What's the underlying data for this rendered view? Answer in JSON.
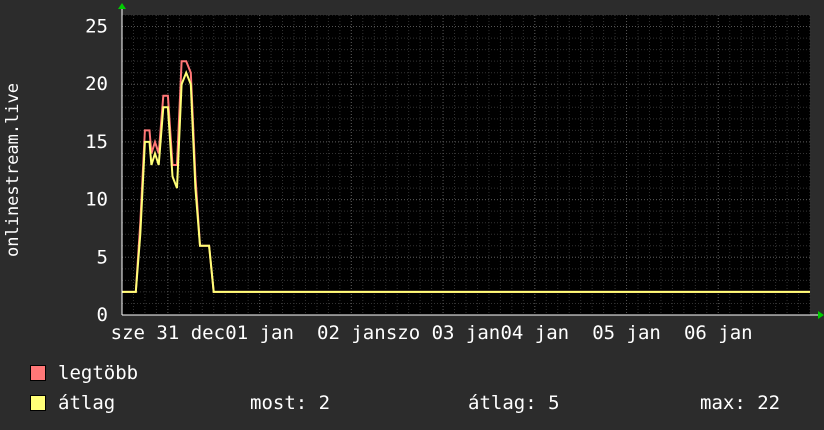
{
  "chart_data": {
    "type": "line",
    "ylabel": "onlinestream.live",
    "ylim": [
      0,
      26
    ],
    "yticks": [
      0,
      5,
      10,
      15,
      20,
      25
    ],
    "xticks": [
      "sze 31 dec",
      "01 jan",
      "02 jan",
      "szo 03 jan",
      "04 jan",
      "05 jan",
      "06 jan"
    ],
    "xtick_positions": [
      0.5,
      1.5,
      2.5,
      3.5,
      4.5,
      5.5,
      6.5
    ],
    "xlim": [
      0,
      7.5
    ],
    "grid": true,
    "colors": {
      "max": "#ff7777",
      "avg": "#ffff77",
      "background": "#000000",
      "grid": "#555555",
      "axis": "#ffffff",
      "arrow": "#00cc00"
    },
    "series": [
      {
        "name": "legtöbb",
        "x": [
          0,
          0.05,
          0.1,
          0.15,
          0.2,
          0.25,
          0.3,
          0.32,
          0.36,
          0.4,
          0.45,
          0.5,
          0.55,
          0.6,
          0.65,
          0.7,
          0.75,
          0.8,
          0.85,
          0.9,
          0.95,
          1.0,
          1.05,
          1.1,
          1.15,
          1.2,
          1.25,
          1.3,
          1.5,
          1.6,
          1.7,
          1.8,
          1.9,
          2.0,
          2.1,
          2.2,
          2.3,
          2.4,
          2.5,
          2.6,
          2.7,
          2.8,
          2.9,
          2.95,
          3.0,
          3.05,
          3.1,
          3.15,
          3.2,
          3.25,
          3.3,
          3.4,
          3.5,
          3.6,
          3.7,
          3.8,
          3.9,
          4.0,
          4.1,
          4.2,
          4.3,
          4.4,
          4.5,
          4.55,
          4.6,
          4.65,
          4.7,
          4.75,
          4.8,
          4.9,
          5.0,
          5.1,
          5.2,
          5.3,
          5.4,
          5.5,
          5.6,
          5.7,
          5.8,
          5.9,
          6.0,
          6.1,
          6.2,
          6.3,
          6.4,
          6.5,
          6.6,
          6.7,
          6.8,
          6.9,
          7.0,
          7.1,
          7.2,
          7.3,
          7.4,
          7.5
        ],
        "values": [
          2,
          2,
          2,
          2,
          8,
          16,
          16,
          14,
          15,
          14,
          19,
          19,
          13,
          13,
          22,
          22,
          21,
          12,
          6,
          6,
          6,
          2,
          2,
          2,
          2,
          2,
          2,
          2,
          2,
          2,
          2,
          2,
          2,
          2,
          2,
          2,
          2,
          2,
          2,
          2,
          2,
          2,
          2,
          2,
          2,
          2,
          2,
          2,
          2,
          2,
          2,
          2,
          2,
          2,
          2,
          2,
          2,
          2,
          2,
          2,
          2,
          2,
          2,
          2,
          2,
          2,
          2,
          2,
          2,
          2,
          2,
          2,
          2,
          2,
          2,
          2,
          2,
          2,
          2,
          2,
          2,
          2,
          2,
          2,
          2,
          2,
          2,
          2,
          2,
          2,
          2,
          2,
          2,
          2,
          2,
          2
        ]
      },
      {
        "name": "átlag",
        "x": [
          0,
          0.05,
          0.1,
          0.15,
          0.2,
          0.25,
          0.3,
          0.32,
          0.36,
          0.4,
          0.45,
          0.5,
          0.55,
          0.6,
          0.65,
          0.7,
          0.75,
          0.8,
          0.85,
          0.9,
          0.95,
          1.0,
          1.05,
          1.1,
          1.15,
          1.2,
          1.25,
          1.3,
          1.5,
          1.6,
          1.7,
          1.8,
          1.9,
          2.0,
          2.1,
          2.2,
          2.3,
          2.4,
          2.5,
          2.6,
          2.7,
          2.8,
          2.9,
          2.95,
          3.0,
          3.05,
          3.1,
          3.15,
          3.2,
          3.25,
          3.3,
          3.4,
          3.5,
          3.6,
          3.7,
          3.8,
          3.9,
          4.0,
          4.1,
          4.2,
          4.3,
          4.4,
          4.5,
          4.55,
          4.6,
          4.65,
          4.7,
          4.75,
          4.8,
          4.9,
          5.0,
          5.1,
          5.2,
          5.3,
          5.4,
          5.5,
          5.6,
          5.7,
          5.8,
          5.9,
          6.0,
          6.1,
          6.2,
          6.3,
          6.4,
          6.5,
          6.6,
          6.7,
          6.8,
          6.9,
          7.0,
          7.1,
          7.2,
          7.3,
          7.4,
          7.5
        ],
        "values": [
          2,
          2,
          2,
          2,
          7,
          15,
          15,
          13,
          14,
          13,
          18,
          18,
          12,
          11,
          20,
          21,
          20,
          11,
          6,
          6,
          6,
          2,
          2,
          2,
          2,
          2,
          2,
          2,
          2,
          2,
          2,
          2,
          2,
          2,
          2,
          2,
          2,
          2,
          2,
          2,
          2,
          2,
          2,
          2,
          2,
          2,
          2,
          2,
          2,
          2,
          2,
          2,
          2,
          2,
          2,
          2,
          2,
          2,
          2,
          2,
          2,
          2,
          2,
          2,
          2,
          2,
          2,
          2,
          2,
          2,
          2,
          2,
          2,
          2,
          2,
          2,
          2,
          2,
          2,
          2,
          2,
          2,
          2,
          2,
          2,
          2,
          2,
          2,
          2,
          2,
          2,
          2,
          2,
          2,
          2,
          2
        ]
      }
    ]
  },
  "legend": {
    "max_label": "legtöbb",
    "avg_label": "átlag",
    "now": "most: 2",
    "avg": "átlag: 5",
    "max": "max: 22"
  }
}
